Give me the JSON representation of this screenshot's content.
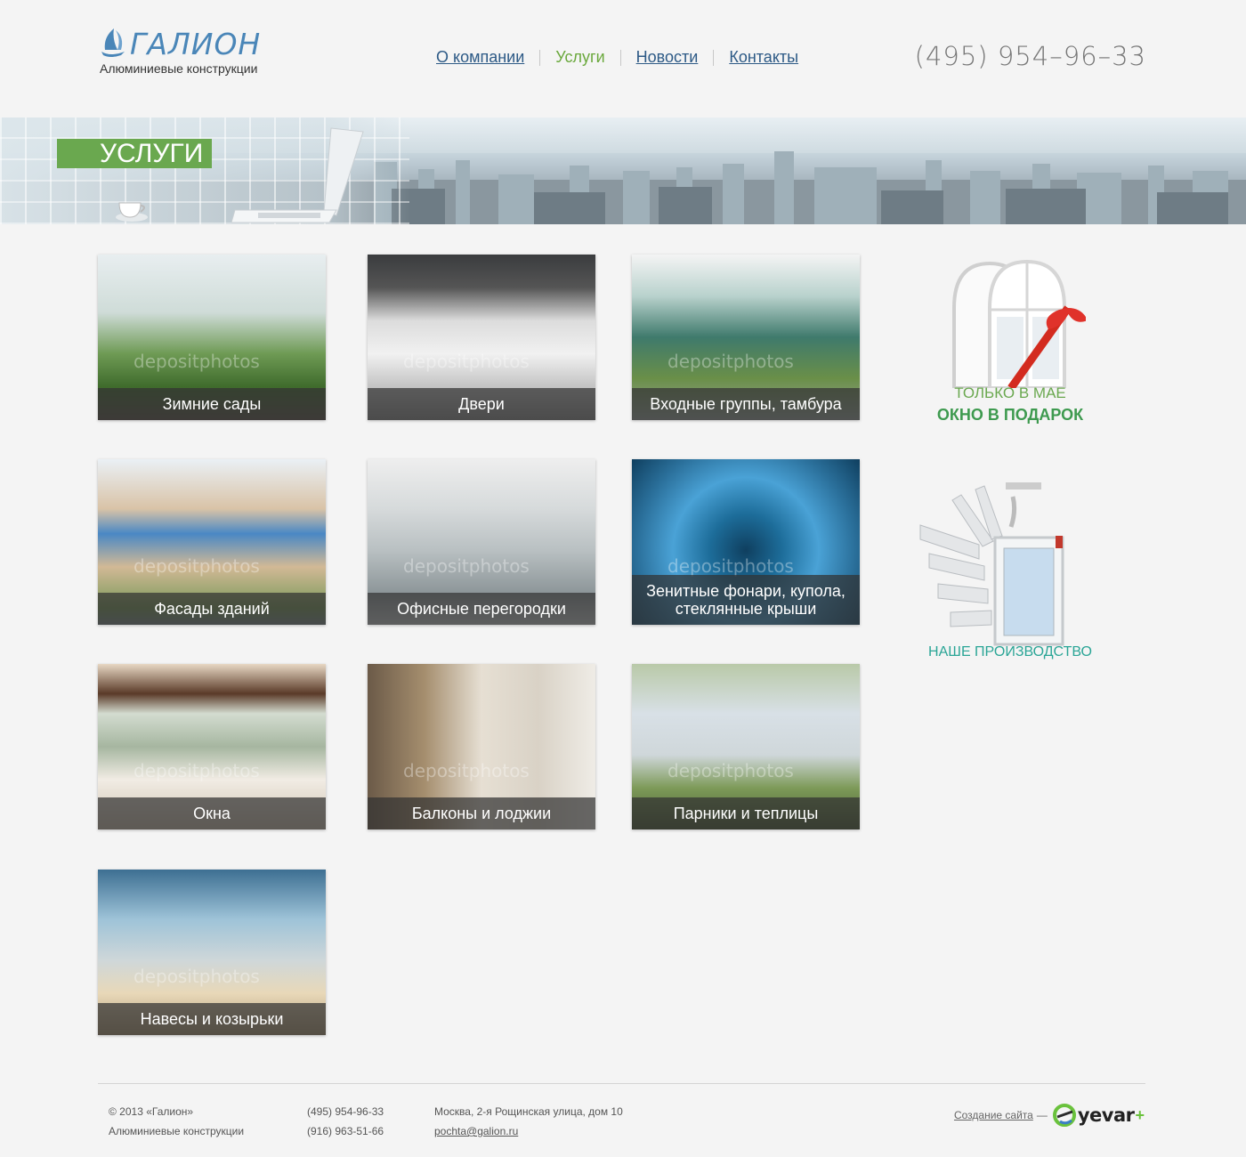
{
  "header": {
    "logo_title": "ГАЛИОН",
    "logo_subtitle": "Алюминиевые конструкции",
    "nav": [
      {
        "label": "О компании",
        "active": false
      },
      {
        "label": "Услуги",
        "active": true
      },
      {
        "label": "Новости",
        "active": false
      },
      {
        "label": "Контакты",
        "active": false
      }
    ],
    "phone": "(495) 954–96–33"
  },
  "banner": {
    "title": "УСЛУГИ"
  },
  "services": [
    {
      "label": "Зимние сады",
      "image": "winter-garden"
    },
    {
      "label": "Двери",
      "image": "doors"
    },
    {
      "label": "Входные группы, тамбура",
      "image": "entrance-groups"
    },
    {
      "label": "Фасады зданий",
      "image": "building-facade"
    },
    {
      "label": "Офисные перегородки",
      "image": "office-partitions"
    },
    {
      "label": "Зенитные фонари, купола, стеклянные крыши",
      "image": "skylight-dome"
    },
    {
      "label": "Окна",
      "image": "windows"
    },
    {
      "label": "Балконы и лоджии",
      "image": "balcony"
    },
    {
      "label": "Парники и теплицы",
      "image": "greenhouse"
    },
    {
      "label": "Навесы и козырьки",
      "image": "canopy"
    }
  ],
  "watermark": "depositphotos",
  "promos": {
    "gift": {
      "line1": "ТОЛЬКО В МАЕ",
      "line2": "ОКНО В ПОДАРОК"
    },
    "production": {
      "label": "НАШЕ ПРОИЗВОДСТВО"
    }
  },
  "footer": {
    "copyright": "© 2013 «Галион»",
    "company_desc": "Алюминиевые конструкции",
    "phone1": "(495) 954-96-33",
    "phone2": "(916) 963-51-66",
    "address": "Москва, 2-я Рощинская улица, дом 10",
    "email": "pochta@galion.ru",
    "made_by_label": "Создание сайта",
    "made_by_dash": "—",
    "made_by_brand": "yevar"
  },
  "colors": {
    "accent_green": "#6aa84f",
    "link_blue": "#2d5a86",
    "logo_blue": "#4a86b8",
    "promo_teal": "#2aa596"
  }
}
